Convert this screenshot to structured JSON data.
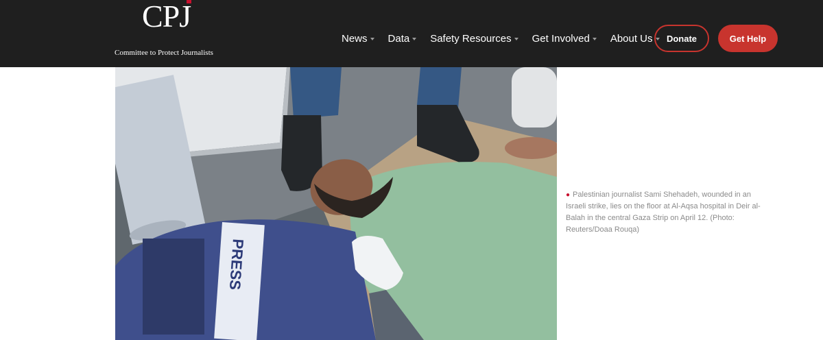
{
  "brand": {
    "logo_text": "CPJ",
    "tagline": "Committee to Protect Journalists",
    "accent_color": "#c8342e",
    "header_bg": "#1f1f1f"
  },
  "nav": {
    "items": [
      {
        "label": "News"
      },
      {
        "label": "Data"
      },
      {
        "label": "Safety Resources"
      },
      {
        "label": "Get Involved"
      },
      {
        "label": "About Us"
      }
    ],
    "donate_label": "Donate",
    "get_help_label": "Get Help"
  },
  "figure": {
    "vest_text": "PRESS",
    "caption": "Palestinian journalist Sami Shehadeh, wounded in an Israeli strike, lies on the floor at Al-Aqsa hospital in Deir al-Balah in the central Gaza Strip on April 12. (Photo: Reuters/Doaa Rouqa)"
  }
}
